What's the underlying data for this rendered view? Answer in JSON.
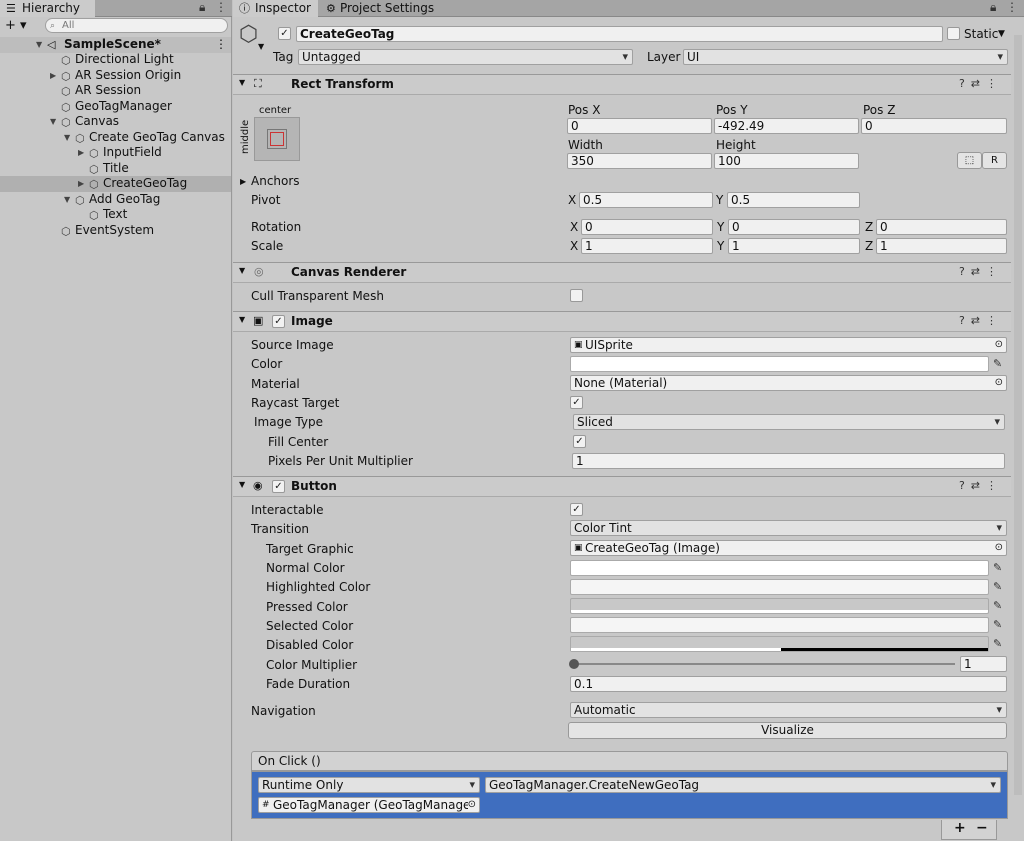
{
  "hierarchy": {
    "tab": "Hierarchy",
    "add": "+ ▾",
    "search_placeholder": "All",
    "scene": "SampleScene*",
    "items": [
      "Directional Light",
      "AR Session Origin",
      "AR Session",
      "GeoTagManager",
      "Canvas",
      "Create GeoTag Canvas",
      "InputField",
      "Title",
      "CreateGeoTag",
      "Add GeoTag",
      "Text",
      "EventSystem"
    ]
  },
  "inspector": {
    "tab": "Inspector",
    "tab2": "Project Settings",
    "object_name": "CreateGeoTag",
    "static_label": "Static",
    "tag_label": "Tag",
    "tag_value": "Untagged",
    "layer_label": "Layer",
    "layer_value": "UI"
  },
  "rect": {
    "title": "Rect Transform",
    "anchor_top": "center",
    "anchor_side": "middle",
    "posx_l": "Pos X",
    "posy_l": "Pos Y",
    "posz_l": "Pos Z",
    "posx": "0",
    "posy": "-492.49",
    "posz": "0",
    "width_l": "Width",
    "height_l": "Height",
    "width": "350",
    "height": "100",
    "r_btn": "R",
    "anchors": "Anchors",
    "pivot": "Pivot",
    "pivx": "0.5",
    "pivy": "0.5",
    "rotation": "Rotation",
    "rx": "0",
    "ry": "0",
    "rz": "0",
    "scale": "Scale",
    "sx": "1",
    "sy": "1",
    "sz": "1",
    "x": "X",
    "y": "Y",
    "z": "Z"
  },
  "canvas_renderer": {
    "title": "Canvas Renderer",
    "cull": "Cull Transparent Mesh"
  },
  "image": {
    "title": "Image",
    "source_l": "Source Image",
    "source": "UISprite",
    "color_l": "Color",
    "material_l": "Material",
    "material": "None (Material)",
    "raycast_l": "Raycast Target",
    "type_l": "Image Type",
    "type": "Sliced",
    "fill_l": "Fill Center",
    "ppu_l": "Pixels Per Unit Multiplier",
    "ppu": "1"
  },
  "button": {
    "title": "Button",
    "interactable": "Interactable",
    "transition_l": "Transition",
    "transition": "Color Tint",
    "target_l": "Target Graphic",
    "target": "CreateGeoTag (Image)",
    "normal": "Normal Color",
    "highlighted": "Highlighted Color",
    "pressed": "Pressed Color",
    "selected": "Selected Color",
    "disabled": "Disabled Color",
    "multiplier_l": "Color Multiplier",
    "multiplier": "1",
    "fade_l": "Fade Duration",
    "fade": "0.1",
    "nav_l": "Navigation",
    "nav": "Automatic",
    "visualize": "Visualize",
    "onclick": "On Click ()",
    "runtime": "Runtime Only",
    "func": "GeoTagManager.CreateNewGeoTag",
    "obj": "GeoTagManager (GeoTagManager",
    "plus": "+",
    "minus": "−"
  },
  "colors": {
    "onclick_bg": "#3f6ebf"
  }
}
